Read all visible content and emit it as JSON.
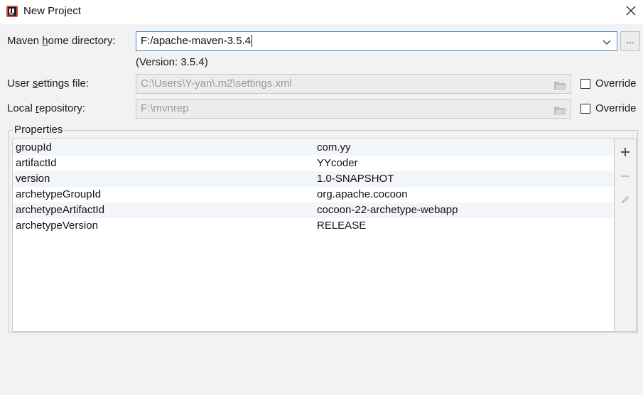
{
  "window": {
    "title": "New Project",
    "app_icon": "intellij-idea-icon"
  },
  "maven": {
    "home_label_pre": "Maven ",
    "home_label_mnemonic": "h",
    "home_label_post": "ome directory:",
    "home_value": "F:/apache-maven-3.5.4",
    "browse_label": "...",
    "version_note": "(Version: 3.5.4)",
    "settings_label_pre": "User ",
    "settings_label_mnemonic": "s",
    "settings_label_post": "ettings file:",
    "settings_value": "C:\\Users\\Y-yan\\.m2\\settings.xml",
    "repo_label_pre": "Local ",
    "repo_label_mnemonic": "r",
    "repo_label_post": "epository:",
    "repo_value": "F:\\mvnrep",
    "override_label": "Override"
  },
  "properties": {
    "title": "Properties",
    "rows": [
      {
        "key": "groupId",
        "value": "com.yy"
      },
      {
        "key": "artifactId",
        "value": "YYcoder"
      },
      {
        "key": "version",
        "value": "1.0-SNAPSHOT"
      },
      {
        "key": "archetypeGroupId",
        "value": "org.apache.cocoon"
      },
      {
        "key": "archetypeArtifactId",
        "value": "cocoon-22-archetype-webapp"
      },
      {
        "key": "archetypeVersion",
        "value": "RELEASE"
      }
    ],
    "toolbar": [
      "plus-icon",
      "minus-icon",
      "pencil-icon"
    ]
  },
  "colors": {
    "accent_border": "#4a86c7",
    "dialog_bg": "#f2f2f2",
    "alt_row": "#f2f5f9"
  }
}
